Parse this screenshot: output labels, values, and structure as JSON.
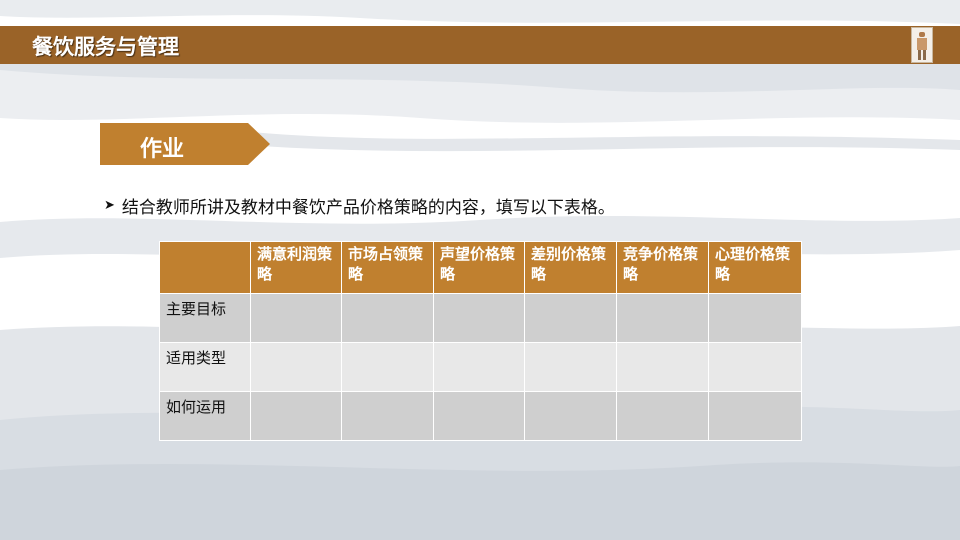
{
  "header": {
    "title": "餐饮服务与管理"
  },
  "section": {
    "tag": "作业"
  },
  "instruction": {
    "bullet_icon": "arrow-right-icon",
    "text": "结合教师所讲及教材中餐饮产品价格策略的内容，填写以下表格。"
  },
  "table": {
    "columns": [
      "满意利润策略",
      "市场占领策略",
      "声望价格策略",
      "差别价格策略",
      "竞争价格策略",
      "心理价格策略"
    ],
    "rows": [
      "主要目标",
      "适用类型",
      "如何运用"
    ],
    "cells": [
      [
        "",
        "",
        "",
        "",
        "",
        ""
      ],
      [
        "",
        "",
        "",
        "",
        "",
        ""
      ],
      [
        "",
        "",
        "",
        "",
        "",
        ""
      ]
    ]
  },
  "colors": {
    "header_bar": "#9a6328",
    "accent": "#c0802f",
    "row_dark": "#cfcfcf",
    "row_light": "#e8e8e8"
  }
}
